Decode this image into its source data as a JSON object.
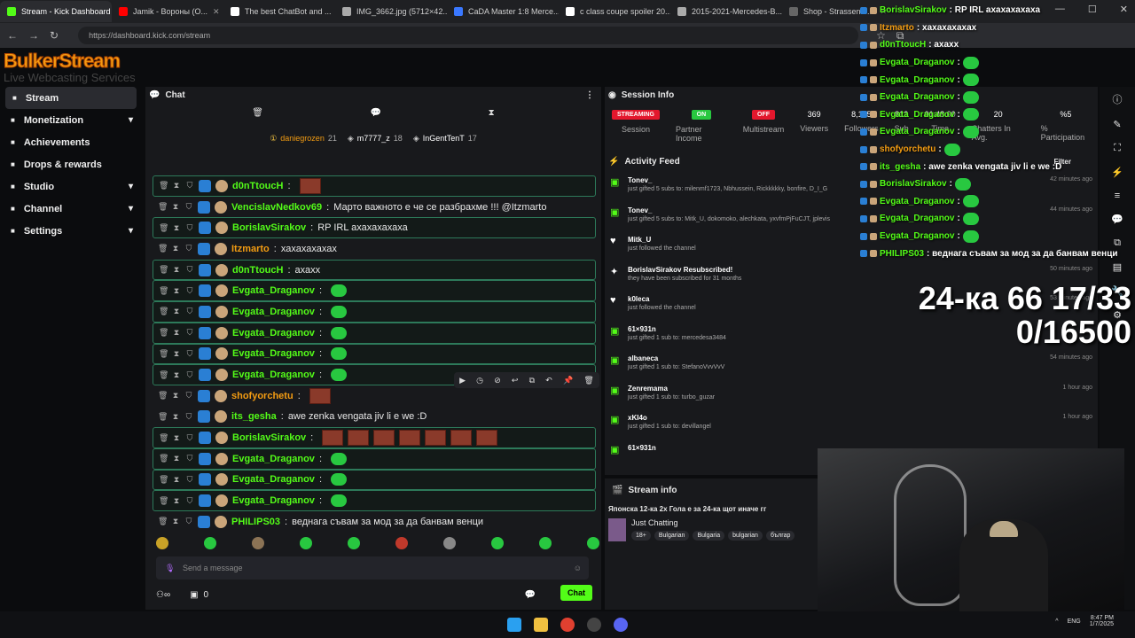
{
  "browser": {
    "tabs": [
      {
        "label": "Stream - Kick Dashboard",
        "color": "#53fc18"
      },
      {
        "label": "Jamik - Вороны (О...",
        "color": "#ff0000"
      },
      {
        "label": "The best ChatBot and ...",
        "color": "#ffffff"
      },
      {
        "label": "IMG_3662.jpg (5712×42...",
        "color": "#aaaaaa"
      },
      {
        "label": "CaDA Master 1:8 Merce...",
        "color": "#3a78ff"
      },
      {
        "label": "c class coupe spoiler 20...",
        "color": "#ffffff"
      },
      {
        "label": "2015-2021-Mercedes-B...",
        "color": "#aaaaaa"
      },
      {
        "label": "Shop - Strassenfe...",
        "color": "#666666"
      }
    ],
    "url": "https://dashboard.kick.com/stream"
  },
  "logo": {
    "line1": "BulkerStream",
    "line2": "Live Webcasting Services"
  },
  "sidebar": {
    "items": [
      {
        "label": "Stream",
        "icon": "stream-icon",
        "chevron": ""
      },
      {
        "label": "Monetization",
        "icon": "dollar-icon",
        "chevron": "▾"
      },
      {
        "label": "Achievements",
        "icon": "trophy-icon",
        "chevron": ""
      },
      {
        "label": "Drops & rewards",
        "icon": "gift-icon",
        "chevron": ""
      },
      {
        "label": "Studio",
        "icon": "studio-icon",
        "chevron": "▾"
      },
      {
        "label": "Channel",
        "icon": "user-icon",
        "chevron": "▾"
      },
      {
        "label": "Settings",
        "icon": "gear-icon",
        "chevron": "▾"
      }
    ]
  },
  "chat": {
    "title": "Chat",
    "top_gifters": [
      {
        "name": "daniegrozen",
        "count": "21"
      },
      {
        "name": "m7777_z",
        "count": "18"
      },
      {
        "name": "InGentTenT",
        "count": "17"
      }
    ],
    "messages": [
      {
        "user": "d0nTtoucH",
        "text": "",
        "color": "#53fc18",
        "emote": "img",
        "hl": true
      },
      {
        "user": "VencislavNedkov69",
        "text": "Марто важното е че се разбрахме !!! @Itzmarto",
        "color": "#53fc18",
        "emote": "",
        "hl": false
      },
      {
        "user": "BorislavSirakov",
        "text": "RP IRL ахахахахаха",
        "color": "#53fc18",
        "emote": "",
        "hl": true
      },
      {
        "user": "Itzmarto",
        "text": "хахахахахах",
        "color": "#f39c12",
        "emote": "",
        "hl": false
      },
      {
        "user": "d0nTtoucH",
        "text": "ахахх",
        "color": "#53fc18",
        "emote": "",
        "hl": true
      },
      {
        "user": "Evgata_Draganov",
        "text": "",
        "color": "#53fc18",
        "emote": "green",
        "hl": true
      },
      {
        "user": "Evgata_Draganov",
        "text": "",
        "color": "#53fc18",
        "emote": "green",
        "hl": true
      },
      {
        "user": "Evgata_Draganov",
        "text": "",
        "color": "#53fc18",
        "emote": "green",
        "hl": true
      },
      {
        "user": "Evgata_Draganov",
        "text": "",
        "color": "#53fc18",
        "emote": "green",
        "hl": true
      },
      {
        "user": "Evgata_Draganov",
        "text": "",
        "color": "#53fc18",
        "emote": "green",
        "hl": true
      },
      {
        "user": "shofyorchetu",
        "text": "",
        "color": "#f39c12",
        "emote": "img",
        "hl": false
      },
      {
        "user": "its_gesha",
        "text": "awe zenka vengata jiv li e we :D",
        "color": "#53fc18",
        "emote": "",
        "hl": false
      },
      {
        "user": "BorislavSirakov",
        "text": "",
        "color": "#53fc18",
        "emote": "imgs",
        "hl": true
      },
      {
        "user": "Evgata_Draganov",
        "text": "",
        "color": "#53fc18",
        "emote": "green",
        "hl": true
      },
      {
        "user": "Evgata_Draganov",
        "text": "",
        "color": "#53fc18",
        "emote": "green",
        "hl": true
      },
      {
        "user": "Evgata_Draganov",
        "text": "",
        "color": "#53fc18",
        "emote": "green",
        "hl": true
      },
      {
        "user": "PHILIPS03",
        "text": "веднага съвам за мод за да банвам венци",
        "color": "#53fc18",
        "emote": "",
        "hl": false
      }
    ],
    "input_placeholder": "Send a message",
    "loyalty_count": "0",
    "chat_button": "Chat"
  },
  "session": {
    "title": "Session Info",
    "stats": [
      {
        "value": "STREAMING",
        "label": "Session",
        "pill": "#e3172d"
      },
      {
        "value": "ON",
        "label": "Partner Income",
        "pill": "#28c840"
      },
      {
        "value": "OFF",
        "label": "Multistream",
        "pill": "#e3172d"
      },
      {
        "value": "369",
        "label": "Viewers",
        "pill": ""
      },
      {
        "value": "8,175",
        "label": "Followers",
        "pill": ""
      },
      {
        "value": "812",
        "label": "Sub",
        "pill": ""
      },
      {
        "value": "01:48:00",
        "label": "Time",
        "pill": ""
      },
      {
        "value": "20",
        "label": "Chatters In Avg.",
        "pill": ""
      },
      {
        "value": "%5",
        "label": "% Participation",
        "pill": ""
      }
    ],
    "feed_title": "Activity Feed",
    "filter": "Filter",
    "feed": [
      {
        "name": "Tonev_",
        "sub": "just gifted 5 subs to: milenmf1723, Nbhussein, Rickkkkky, bonfire, D_I_G",
        "time": "42 minutes ago",
        "icon": "gift-icon"
      },
      {
        "name": "Tonev_",
        "sub": "just gifted 5 subs to: Mitk_U, dokomoko, alechkata, yxvfmPjFuCJT, jplevis",
        "time": "44 minutes ago",
        "icon": "gift-icon"
      },
      {
        "name": "Mitk_U",
        "sub": "just followed the channel",
        "time": "",
        "icon": "heart-icon"
      },
      {
        "name": "BorislavSirakov Resubscribed!",
        "sub": "they have been subscribed for 31 months",
        "time": "50 minutes ago",
        "icon": "star-icon"
      },
      {
        "name": "k0leca",
        "sub": "just followed the channel",
        "time": "53 minutes ago",
        "icon": "heart-icon"
      },
      {
        "name": "61×931n",
        "sub": "just gifted 1 sub to: mercedesa3484",
        "time": "",
        "icon": "gift-icon"
      },
      {
        "name": "albaneca",
        "sub": "just gifted 1 sub to: StefanoVvvVvV",
        "time": "54 minutes ago",
        "icon": "gift-icon"
      },
      {
        "name": "Zenremama",
        "sub": "just gifted 1 sub to: turbo_guzar",
        "time": "1 hour ago",
        "icon": "gift-icon"
      },
      {
        "name": "xKI4o",
        "sub": "just gifted 1 sub to: devillangel",
        "time": "1 hour ago",
        "icon": "gift-icon"
      },
      {
        "name": "61×931n",
        "sub": "",
        "time": "",
        "icon": "gift-icon"
      }
    ]
  },
  "stream_info": {
    "title": "Stream info",
    "stream_title": "Японска 12-ка 2х Гола е за 24-ка щот иначе гг",
    "category": "Just Chatting",
    "tags": [
      "18+",
      "Bulgarian",
      "Bulgaria",
      "bulgarian",
      "българ"
    ]
  },
  "overlay": {
    "lines": [
      {
        "user": "BorislavSirakov",
        "text": ": RP IRL ахахахахаха",
        "color": "#53fc18"
      },
      {
        "user": "Itzmarto",
        "text": ": хахахахахах",
        "color": "#f39c12"
      },
      {
        "user": "d0nTtoucH",
        "text": ": ахахх",
        "color": "#53fc18"
      },
      {
        "user": "Evgata_Draganov",
        "text": " :",
        "color": "#53fc18"
      },
      {
        "user": "Evgata_Draganov",
        "text": " :",
        "color": "#53fc18"
      },
      {
        "user": "Evgata_Draganov",
        "text": " :",
        "color": "#53fc18"
      },
      {
        "user": "Evgata_Draganov",
        "text": " :",
        "color": "#53fc18"
      },
      {
        "user": "Evgata_Draganov",
        "text": " :",
        "color": "#53fc18"
      },
      {
        "user": "shofyorchetu",
        "text": " :",
        "color": "#f39c12"
      },
      {
        "user": "its_gesha",
        "text": ": awe zenka vengata jiv li e we :D",
        "color": "#53fc18"
      },
      {
        "user": "BorislavSirakov",
        "text": " :",
        "color": "#53fc18"
      },
      {
        "user": "Evgata_Draganov",
        "text": " :",
        "color": "#53fc18"
      },
      {
        "user": "Evgata_Draganov",
        "text": " :",
        "color": "#53fc18"
      },
      {
        "user": "Evgata_Draganov",
        "text": " :",
        "color": "#53fc18"
      },
      {
        "user": "PHILIPS03",
        "text": ": веднага съвам за мод за да банвам венци",
        "color": "#53fc18"
      }
    ],
    "big_line1": "24-ка 66 17/33",
    "big_line2": "0/16500"
  },
  "taskbar": {
    "lang": "ENG",
    "time": "8:47 PM",
    "date": "1/7/2025"
  }
}
